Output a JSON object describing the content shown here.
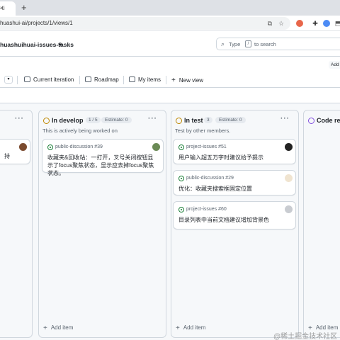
{
  "browser": {
    "tab_label": "-ti",
    "new_tab": "+",
    "url": "huashui-ai/projects/1/views/1"
  },
  "header": {
    "project_title": "huashuihuai-issues-tasks",
    "search_prefix": "Type",
    "search_key": "/",
    "search_suffix": "to search"
  },
  "views": {
    "add_label": "Add",
    "items": [
      {
        "label": "Current iteration"
      },
      {
        "label": "Roadmap"
      },
      {
        "label": "My items"
      },
      {
        "label": "New view"
      }
    ]
  },
  "columns": [
    {
      "name": "",
      "cards": [
        {
          "title": "持"
        }
      ],
      "add_label": ""
    },
    {
      "name": "In develop",
      "count": "1 / 5",
      "estimate": "Estimate: 0",
      "status_color": "#bf8700",
      "description": "This is actively being worked on",
      "cards": [
        {
          "ref": "public-discussion #39",
          "title": "收藏夹&回收站：一打开，叉号关闭按钮显示了focus聚焦状态，显示应去掉focus聚焦状态。"
        }
      ],
      "add_label": "Add item"
    },
    {
      "name": "In test",
      "count": "3",
      "estimate": "Estimate: 0",
      "status_color": "#bf8700",
      "description": "Test by other members.",
      "cards": [
        {
          "ref": "project-issues #51",
          "title": "用户输入超五万字时建议给予提示"
        },
        {
          "ref": "public-discussion #29",
          "title": "优化：收藏夹搜索框固定位置"
        },
        {
          "ref": "project-issues #60",
          "title": "目录列表中当前文档建议增加背景色"
        }
      ],
      "add_label": "Add item"
    },
    {
      "name": "Code rev",
      "status_color": "#8250df",
      "add_label": "Add item"
    }
  ],
  "watermark": "@稀土掘金技术社区",
  "colors": {
    "accent": "#0969da",
    "open_issue": "#1a7f37"
  }
}
